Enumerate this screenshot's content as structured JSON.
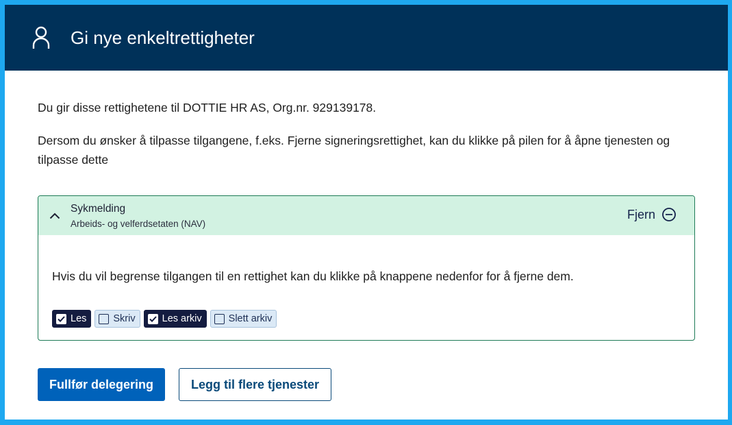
{
  "header": {
    "title": "Gi nye enkeltrettigheter",
    "icon": "person-icon"
  },
  "intro": "Du gir disse rettighetene til DOTTIE HR AS, Org.nr. 929139178.",
  "instructions": "Dersom du ønsker å tilpasse tilgangene, f.eks. Fjerne signeringsrettighet, kan du klikke på pilen for å åpne tjenesten og tilpasse dette",
  "service": {
    "title": "Sykmelding",
    "provider": "Arbeids- og velferdsetaten (NAV)",
    "remove_label": "Fjern",
    "body_text": "Hvis du vil begrense tilgangen til en rettighet kan du klikke på knappene nedenfor for å fjerne dem.",
    "rights": [
      {
        "label": "Les",
        "checked": true
      },
      {
        "label": "Skriv",
        "checked": false
      },
      {
        "label": "Les arkiv",
        "checked": true
      },
      {
        "label": "Slett arkiv",
        "checked": false
      }
    ]
  },
  "actions": {
    "complete_label": "Fullfør delegering",
    "add_more_label": "Legg til flere tjenester"
  },
  "colors": {
    "header_bg": "#003159",
    "accordion_head_bg": "#d2f2e2",
    "primary_button": "#0062ba",
    "chip_checked": "#141c40",
    "chip_unchecked": "#dbe9f6",
    "outer_border": "#1ea8f0"
  }
}
